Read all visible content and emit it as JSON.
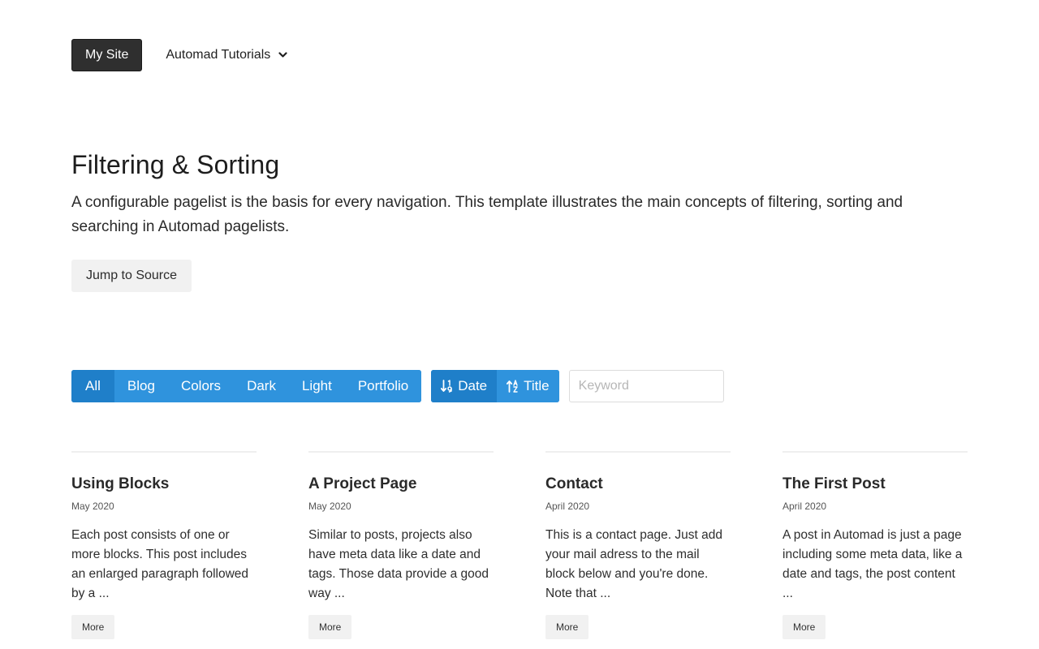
{
  "nav": {
    "brand": "My Site",
    "dropdown_label": "Automad Tutorials",
    "dropdown_icon": "chevron-down-icon"
  },
  "hero": {
    "title": "Filtering & Sorting",
    "description": "A configurable pagelist is the basis for every navigation. This template illustrates the main concepts of filtering, sorting and searching in Automad pagelists.",
    "source_button": "Jump to Source"
  },
  "filters": {
    "items": [
      "All",
      "Blog",
      "Colors",
      "Dark",
      "Light",
      "Portfolio"
    ],
    "active": "All"
  },
  "sort": {
    "date_label": "Date",
    "date_icon": "sort-numeric-down-icon",
    "title_label": "Title",
    "title_icon": "sort-alpha-up-icon",
    "active": "Date"
  },
  "search": {
    "placeholder": "Keyword",
    "value": ""
  },
  "posts": [
    {
      "title": "Using Blocks",
      "date": "May 2020",
      "excerpt": "Each post consists of one or more blocks. This post includes an enlarged paragraph followed by a ...",
      "more": "More"
    },
    {
      "title": "A Project Page",
      "date": "May 2020",
      "excerpt": "Similar to posts, projects also have meta data like a date and tags. Those data provide a good way ...",
      "more": "More"
    },
    {
      "title": "Contact",
      "date": "April 2020",
      "excerpt": "This is a contact page. Just add your mail adress to the mail block below and you're done. Note that ...",
      "more": "More"
    },
    {
      "title": "The First Post",
      "date": "April 2020",
      "excerpt": "A post in Automad is just a page including some meta data, like a date and tags, the post content ...",
      "more": "More"
    }
  ],
  "colors": {
    "accent": "#2f93dd",
    "accent_active": "#1f7fc9",
    "brand_bg": "#2f2f2f",
    "button_light": "#f1f1f1"
  }
}
